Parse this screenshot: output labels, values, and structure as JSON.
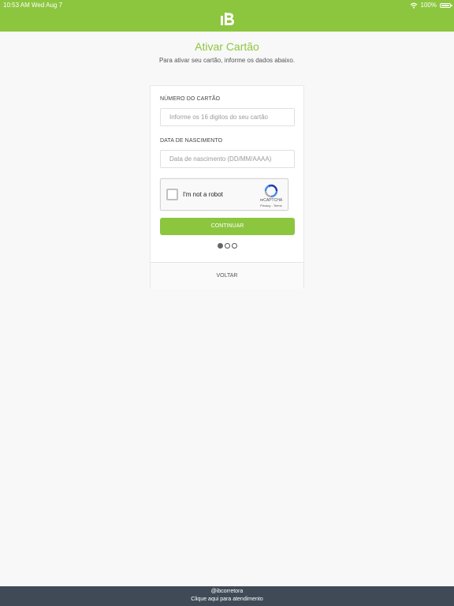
{
  "status_bar": {
    "time": "10:53 AM   Wed Aug 7",
    "battery": "100%"
  },
  "header": {
    "logo_icon": "ib-logo-icon",
    "color": "#8cc63f"
  },
  "page": {
    "title": "Ativar Cartão",
    "subtitle": "Para ativar seu cartão, informe os dados abaixo."
  },
  "form": {
    "card_number": {
      "label": "NÚMERO DO CARTÃO",
      "placeholder": "Informe os 16 digitos do seu cartão",
      "value": ""
    },
    "birth_date": {
      "label": "DATA DE NASCIMENTO",
      "placeholder": "Data de nascimento (DD/MM/AAAA)",
      "value": ""
    },
    "captcha": {
      "label": "I'm not a robot",
      "brand": "reCAPTCHA",
      "terms": "Privacy - Terms",
      "checked": false
    },
    "continue_label": "CONTINUAR",
    "steps": {
      "total": 3,
      "current": 1
    },
    "back_label": "VOLTAR"
  },
  "footer": {
    "handle": "@ibcorretora",
    "link": "Clique aqui para atendimento",
    "color": "#3f4a56"
  }
}
